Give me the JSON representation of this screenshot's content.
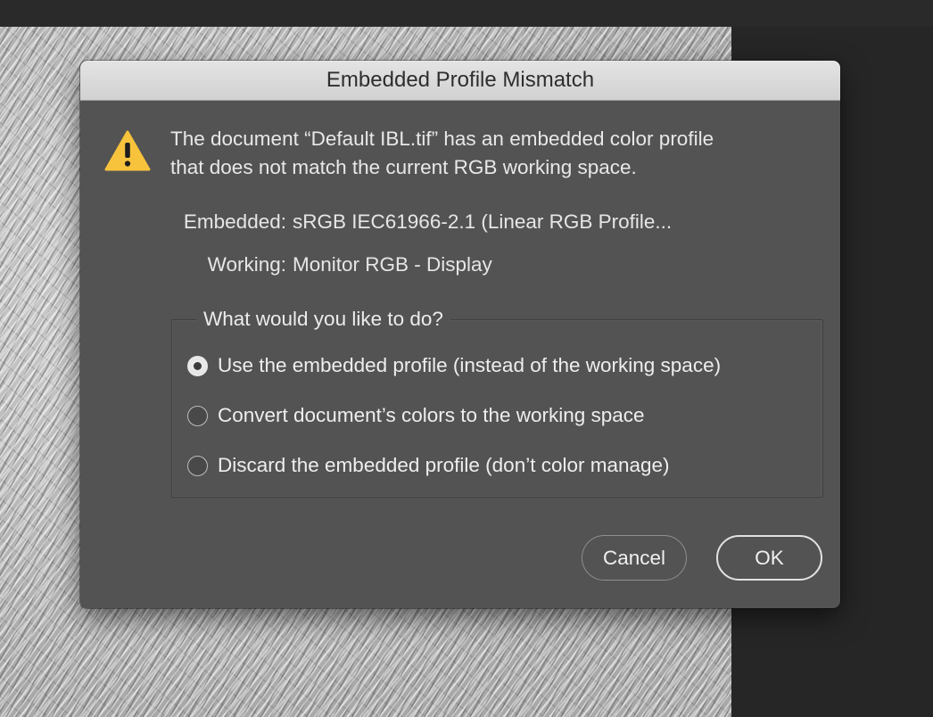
{
  "dialog": {
    "title": "Embedded Profile Mismatch",
    "message_line1": "The document “Default IBL.tif” has an embedded color profile",
    "message_line2": "that does not match the current RGB working space.",
    "embedded_label": "Embedded:",
    "embedded_value": "sRGB IEC61966-2.1 (Linear RGB Profile...",
    "working_label": "Working:",
    "working_value": "Monitor RGB - Display",
    "group_title": "What would you like to do?",
    "options": [
      {
        "label": "Use the embedded profile (instead of the working space)",
        "selected": true
      },
      {
        "label": "Convert document’s colors to the working space",
        "selected": false
      },
      {
        "label": "Discard the embedded profile (don’t color manage)",
        "selected": false
      }
    ],
    "buttons": {
      "cancel": "Cancel",
      "ok": "OK"
    }
  },
  "icons": {
    "warning": "warning-triangle-icon"
  },
  "colors": {
    "dialog_background": "#535353",
    "app_background": "#262626",
    "warning_yellow": "#f8c33c",
    "text": "#e8e8e8"
  }
}
